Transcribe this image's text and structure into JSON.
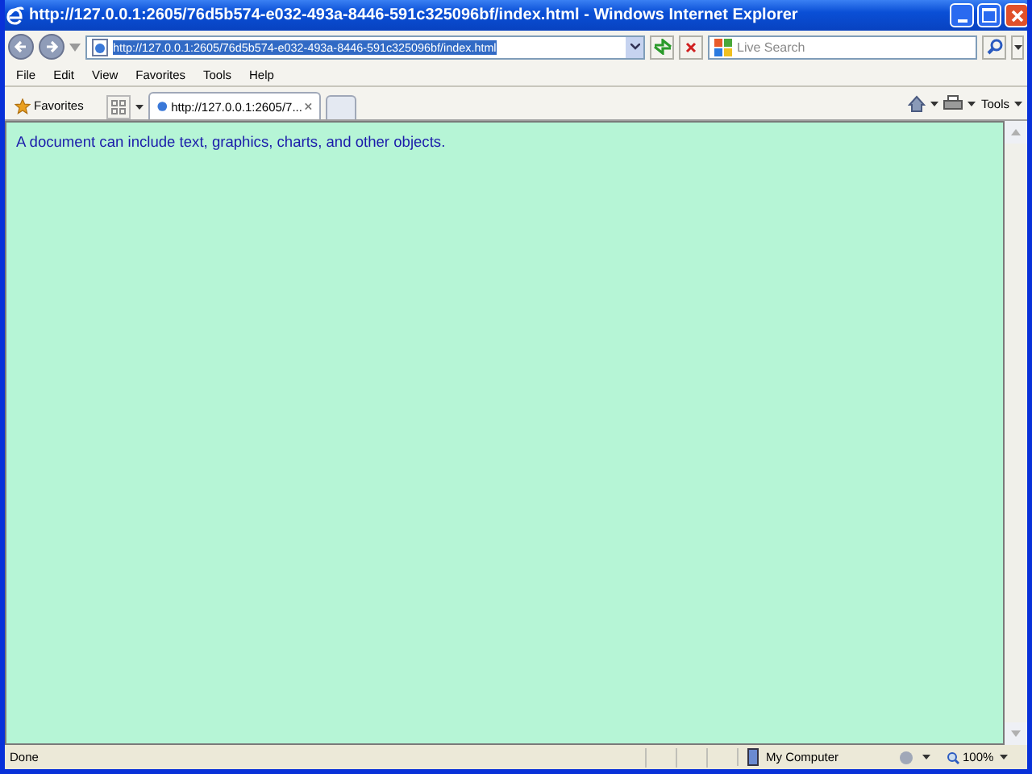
{
  "window": {
    "title": "http://127.0.0.1:2605/76d5b574-e032-493a-8446-591c325096bf/index.html - Windows Internet Explorer"
  },
  "address_bar": {
    "url": "http://127.0.0.1:2605/76d5b574-e032-493a-8446-591c325096bf/index.html",
    "url_selected": true
  },
  "search": {
    "placeholder": "Live Search"
  },
  "menu": [
    "File",
    "Edit",
    "View",
    "Favorites",
    "Tools",
    "Help"
  ],
  "favorites_label": "Favorites",
  "tabs": [
    {
      "label": "http://127.0.0.1:2605/7...",
      "selected": true
    }
  ],
  "command_bar": {
    "tools_label": "Tools"
  },
  "page": {
    "text": "A document can include text, graphics, charts, and other objects."
  },
  "status_bar": {
    "status": "Done",
    "zone": "My Computer",
    "zoom": "100%"
  }
}
